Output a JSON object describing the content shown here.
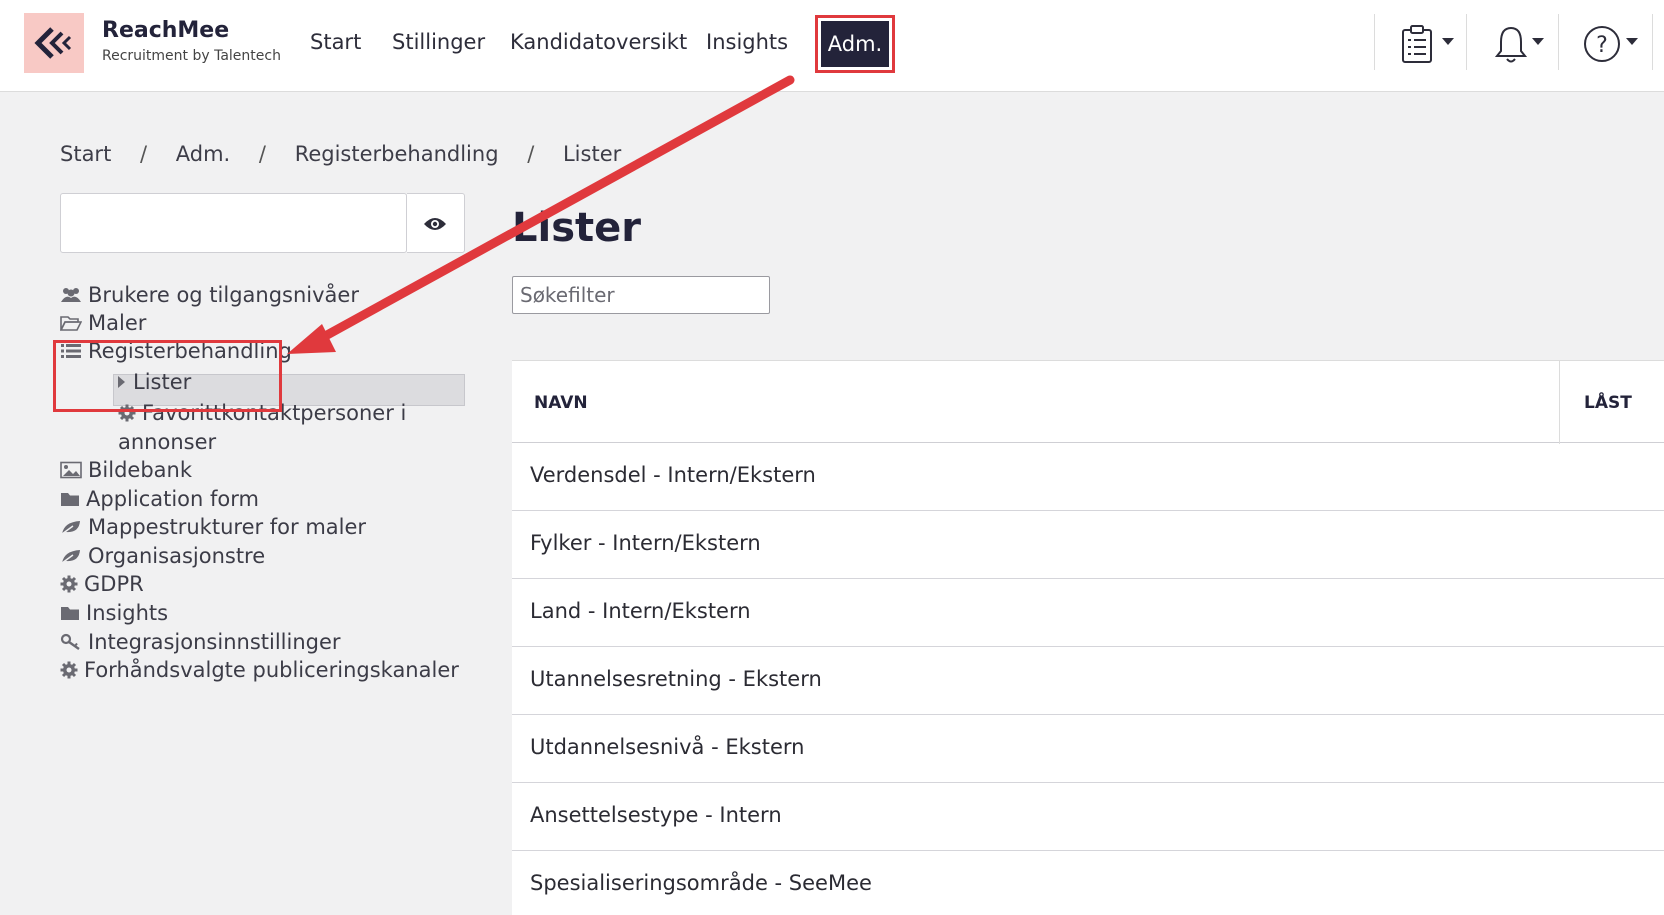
{
  "brand": {
    "name": "ReachMee",
    "subtitle": "Recruitment by Talentech"
  },
  "nav": {
    "items": [
      {
        "label": "Start"
      },
      {
        "label": "Stillinger"
      },
      {
        "label": "Kandidatoversikt"
      },
      {
        "label": "Insights"
      },
      {
        "label": "Adm."
      }
    ],
    "icons": [
      "clipboard-icon",
      "bell-icon",
      "help-icon"
    ]
  },
  "breadcrumb": {
    "items": [
      "Start",
      "Adm.",
      "Registerbehandling",
      "Lister"
    ],
    "separator": "/"
  },
  "sidebar": {
    "search_value": "",
    "items": [
      {
        "label": "Brukere og tilgangsnivåer",
        "icon": "users-icon"
      },
      {
        "label": "Maler",
        "icon": "folder-open-icon"
      },
      {
        "label": "Registerbehandling",
        "icon": "list-icon"
      },
      {
        "label": "Lister",
        "icon": "caret-right-icon",
        "selected": true
      },
      {
        "label": "Favorittkontaktpersoner i",
        "label2": "annonser",
        "icon": "gear-icon"
      },
      {
        "label": "Bildebank",
        "icon": "image-icon"
      },
      {
        "label": "Application form",
        "icon": "folder-icon"
      },
      {
        "label": "Mappestrukturer for maler",
        "icon": "leaf-icon"
      },
      {
        "label": "Organisasjonstre",
        "icon": "leaf-icon"
      },
      {
        "label": "GDPR",
        "icon": "gear-icon"
      },
      {
        "label": "Insights",
        "icon": "folder-icon"
      },
      {
        "label": "Integrasjonsinnstillinger",
        "icon": "key-icon"
      },
      {
        "label": "Forhåndsvalgte publiceringskanaler",
        "icon": "gear-icon"
      }
    ]
  },
  "main": {
    "title": "Lister",
    "filter_placeholder": "Søkefilter",
    "columns": [
      "NAVN",
      "LÅST"
    ],
    "rows": [
      "Verdensdel - Intern/Ekstern",
      "Fylker - Intern/Ekstern",
      "Land - Intern/Ekstern",
      "Utannelsesretning - Ekstern",
      "Utdannelsesnivå - Ekstern",
      "Ansettelsestype - Intern",
      "Spesialiseringsområde - SeeMee"
    ]
  },
  "colors": {
    "accent": "#23233a",
    "highlight": "#e0393d",
    "logo_bg": "#f8c9c5"
  }
}
